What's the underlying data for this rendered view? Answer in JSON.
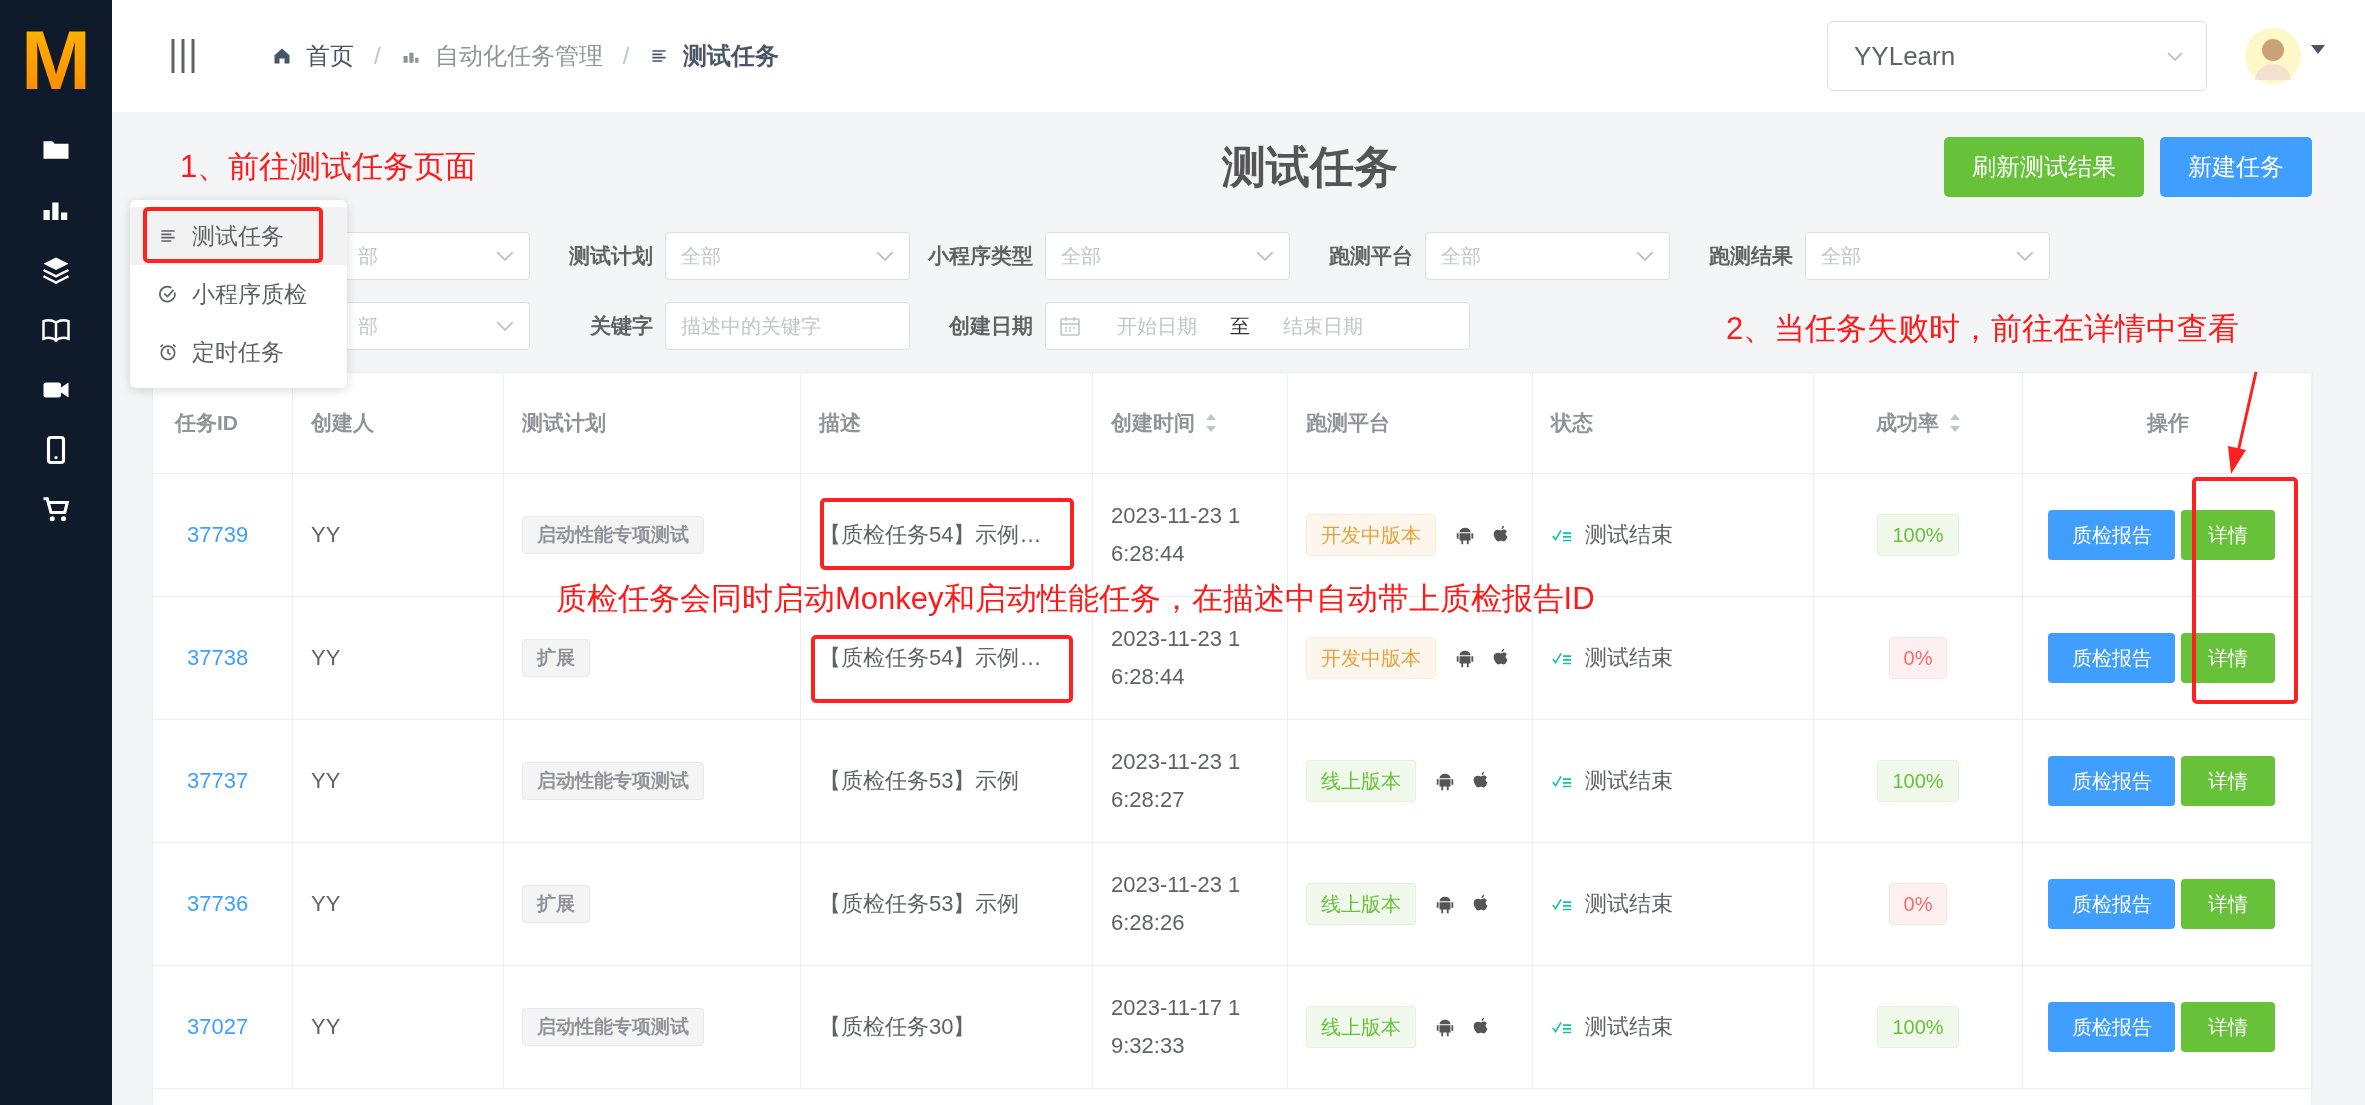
{
  "sidebar": {
    "logo": "M"
  },
  "header": {
    "breadcrumb": [
      {
        "label": "首页",
        "current": false
      },
      {
        "label": "自动化任务管理",
        "current": false
      },
      {
        "label": "测试任务",
        "current": true
      }
    ],
    "breadcrumb_separator": "/",
    "project": "YYLearn"
  },
  "popup_menu": [
    {
      "label": "测试任务",
      "selected": true
    },
    {
      "label": "小程序质检",
      "selected": false
    },
    {
      "label": "定时任务",
      "selected": false
    }
  ],
  "page_title": "测试任务",
  "actions": [
    {
      "label": "刷新测试结果",
      "kind": "success"
    },
    {
      "label": "新建任务",
      "kind": "primary"
    }
  ],
  "filters": [
    [
      {
        "kind": "select",
        "placeholder": "部"
      },
      {
        "kind": "select",
        "label": "测试计划",
        "placeholder": "全部"
      },
      {
        "kind": "select",
        "label": "小程序类型",
        "placeholder": "全部"
      },
      {
        "kind": "select",
        "label": "跑测平台",
        "placeholder": "全部"
      },
      {
        "kind": "select",
        "label": "跑测结果",
        "placeholder": "全部"
      }
    ],
    [
      {
        "kind": "select",
        "placeholder": "部"
      },
      {
        "kind": "input",
        "label": "关键字",
        "placeholder": "描述中的关键字"
      },
      {
        "kind": "daterange",
        "label": "创建日期",
        "start_placeholder": "开始日期",
        "separator": "至",
        "end_placeholder": "结束日期"
      }
    ]
  ],
  "table": {
    "columns": [
      {
        "label": "任务ID",
        "sortable": false
      },
      {
        "label": "创建人",
        "sortable": false
      },
      {
        "label": "测试计划",
        "sortable": false
      },
      {
        "label": "描述",
        "sortable": false
      },
      {
        "label": "创建时间",
        "sortable": true
      },
      {
        "label": "跑测平台",
        "sortable": false
      },
      {
        "label": "状态",
        "sortable": false
      },
      {
        "label": "成功率",
        "sortable": true
      },
      {
        "label": "操作",
        "sortable": false
      }
    ],
    "rows": [
      {
        "id": "37739",
        "creator": "YY",
        "plan": "启动性能专项测试",
        "description": "【质检任务54】示例…",
        "created": "2023-11-23 16:28:44",
        "platform": {
          "label": "开发中版本",
          "kind": "dev"
        },
        "status": "测试结束",
        "rate": {
          "label": "100%",
          "kind": "success"
        },
        "actions": [
          {
            "label": "质检报告",
            "kind": "primary"
          },
          {
            "label": "详情",
            "kind": "success"
          }
        ]
      },
      {
        "id": "37738",
        "creator": "YY",
        "plan": "扩展",
        "description": "【质检任务54】示例…",
        "created": "2023-11-23 16:28:44",
        "platform": {
          "label": "开发中版本",
          "kind": "dev"
        },
        "status": "测试结束",
        "rate": {
          "label": "0%",
          "kind": "danger"
        },
        "actions": [
          {
            "label": "质检报告",
            "kind": "primary"
          },
          {
            "label": "详情",
            "kind": "success"
          }
        ]
      },
      {
        "id": "37737",
        "creator": "YY",
        "plan": "启动性能专项测试",
        "description": "【质检任务53】示例",
        "created": "2023-11-23 16:28:27",
        "platform": {
          "label": "线上版本",
          "kind": "online"
        },
        "status": "测试结束",
        "rate": {
          "label": "100%",
          "kind": "success"
        },
        "actions": [
          {
            "label": "质检报告",
            "kind": "primary"
          },
          {
            "label": "详情",
            "kind": "success"
          }
        ]
      },
      {
        "id": "37736",
        "creator": "YY",
        "plan": "扩展",
        "description": "【质检任务53】示例",
        "created": "2023-11-23 16:28:26",
        "platform": {
          "label": "线上版本",
          "kind": "online"
        },
        "status": "测试结束",
        "rate": {
          "label": "0%",
          "kind": "danger"
        },
        "actions": [
          {
            "label": "质检报告",
            "kind": "primary"
          },
          {
            "label": "详情",
            "kind": "success"
          }
        ]
      },
      {
        "id": "37027",
        "creator": "YY",
        "plan": "启动性能专项测试",
        "description": "【质检任务30】",
        "created": "2023-11-17 19:32:33",
        "platform": {
          "label": "线上版本",
          "kind": "online"
        },
        "status": "测试结束",
        "rate": {
          "label": "100%",
          "kind": "success"
        },
        "actions": [
          {
            "label": "质检报告",
            "kind": "primary"
          },
          {
            "label": "详情",
            "kind": "success"
          }
        ]
      }
    ]
  },
  "annotations": [
    {
      "text": "1、前往测试任务页面"
    },
    {
      "text": "2、当任务失败时，前往在详情中查看"
    },
    {
      "text": "质检任务会同时启动Monkey和启动性能任务，在描述中自动带上质检报告ID"
    }
  ]
}
